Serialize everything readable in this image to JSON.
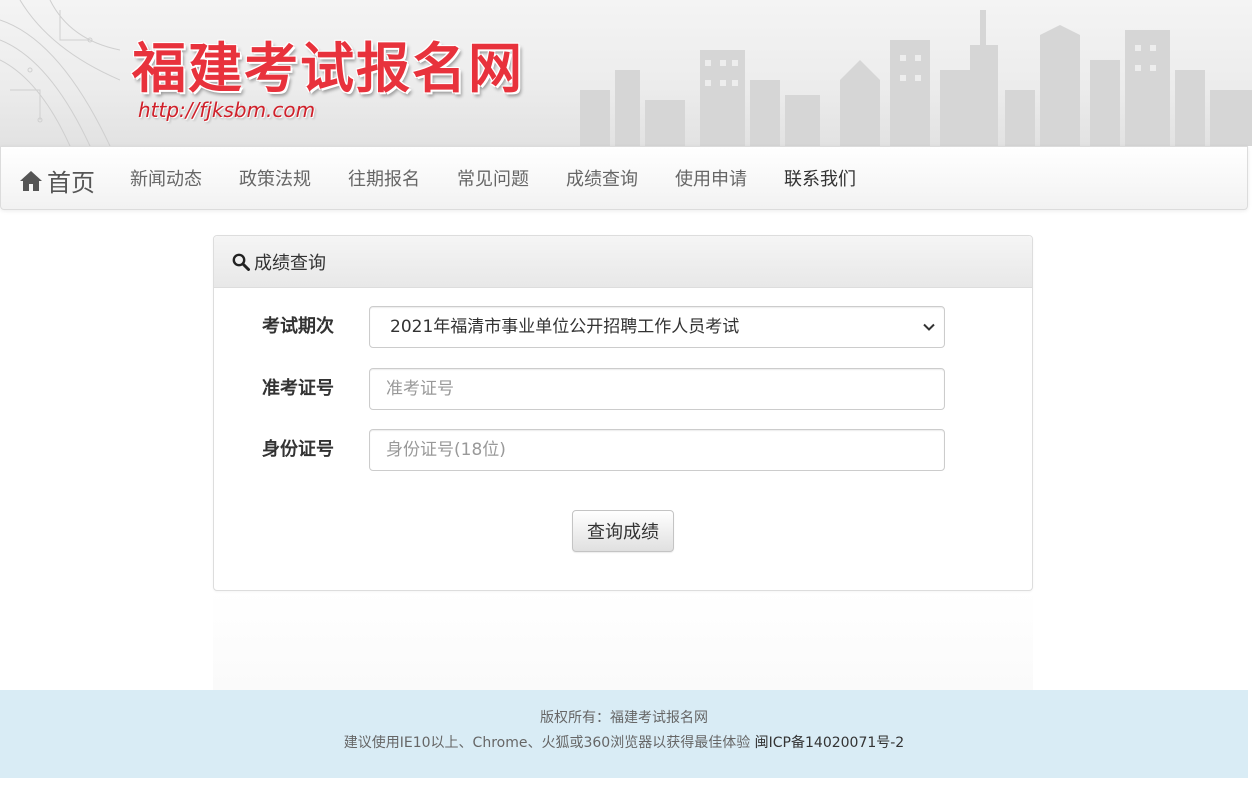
{
  "banner": {
    "site_title": "福建考试报名网",
    "site_url": "http://fjksbm.com"
  },
  "nav": {
    "home_label": "首页",
    "items": [
      "新闻动态",
      "政策法规",
      "往期报名",
      "常见问题",
      "成绩查询",
      "使用申请",
      "联系我们"
    ]
  },
  "panel": {
    "heading": "成绩查询",
    "exam_period_label": "考试期次",
    "exam_period_value": "2021年福清市事业单位公开招聘工作人员考试",
    "ticket_label": "准考证号",
    "ticket_placeholder": "准考证号",
    "id_label": "身份证号",
    "id_placeholder": "身份证号(18位)",
    "submit_label": "查询成绩"
  },
  "footer": {
    "copyright": "版权所有：福建考试报名网",
    "browser_note": "建议使用IE10以上、Chrome、火狐或360浏览器以获得最佳体验",
    "icp": "闽ICP备14020071号-2"
  },
  "colors": {
    "title_red": "#e8323c",
    "footer_bg": "#d9ecf5"
  }
}
